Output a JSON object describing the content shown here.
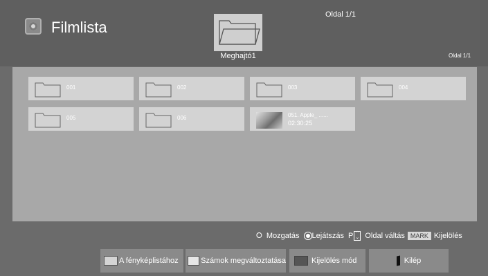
{
  "header": {
    "title": "Filmlista",
    "drive_label": "Meghajtó1",
    "page_top": "Oldal 1/1",
    "page_right": "Oldal 1/1"
  },
  "items": [
    {
      "label": "001"
    },
    {
      "label": "002"
    },
    {
      "label": "003"
    },
    {
      "label": "004"
    },
    {
      "label": "005"
    },
    {
      "label": "006"
    },
    {
      "label": "051. Apple_ ......",
      "duration": "02:30:25"
    }
  ],
  "hints": {
    "move": "Mozgatás",
    "play": "Lejátszás",
    "p": "P",
    "page_change": "Oldal váltás",
    "mark_key": "MARK",
    "mark": "Kijelölés"
  },
  "buttons": {
    "photo_list": "A fényképlistához",
    "change_numbers": "Számok megváltoztatása",
    "mark_mode": "Kijelölés mód",
    "exit": "Kilép"
  },
  "colors": {
    "swatch_red": "#d4d4d4",
    "swatch_green": "#e6e6e6",
    "swatch_yellow": "#555555"
  }
}
